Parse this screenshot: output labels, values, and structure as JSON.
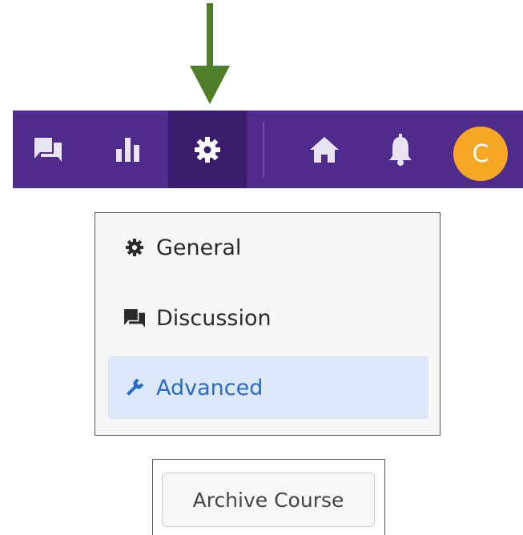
{
  "annotation": {
    "arrow_icon": "down-arrow",
    "arrow_color": "#4f7f2b"
  },
  "topbar": {
    "background": "#4f2b8c",
    "active_background": "#3b1d6e",
    "buttons": [
      {
        "icon": "discussion-icon"
      },
      {
        "icon": "chart-icon"
      },
      {
        "icon": "gear-icon",
        "active": true
      },
      {
        "icon": "home-icon"
      },
      {
        "icon": "bell-icon"
      }
    ],
    "avatar": {
      "initial": "C",
      "color": "#f5a623"
    }
  },
  "settings_menu": {
    "items": [
      {
        "label": "General",
        "icon": "gear-icon"
      },
      {
        "label": "Discussion",
        "icon": "discussion-icon"
      },
      {
        "label": "Advanced",
        "icon": "wrench-icon",
        "active": true
      }
    ],
    "active_color": "#2b6ac8",
    "active_background": "#dce7f7"
  },
  "archive": {
    "button_label": "Archive Course"
  }
}
